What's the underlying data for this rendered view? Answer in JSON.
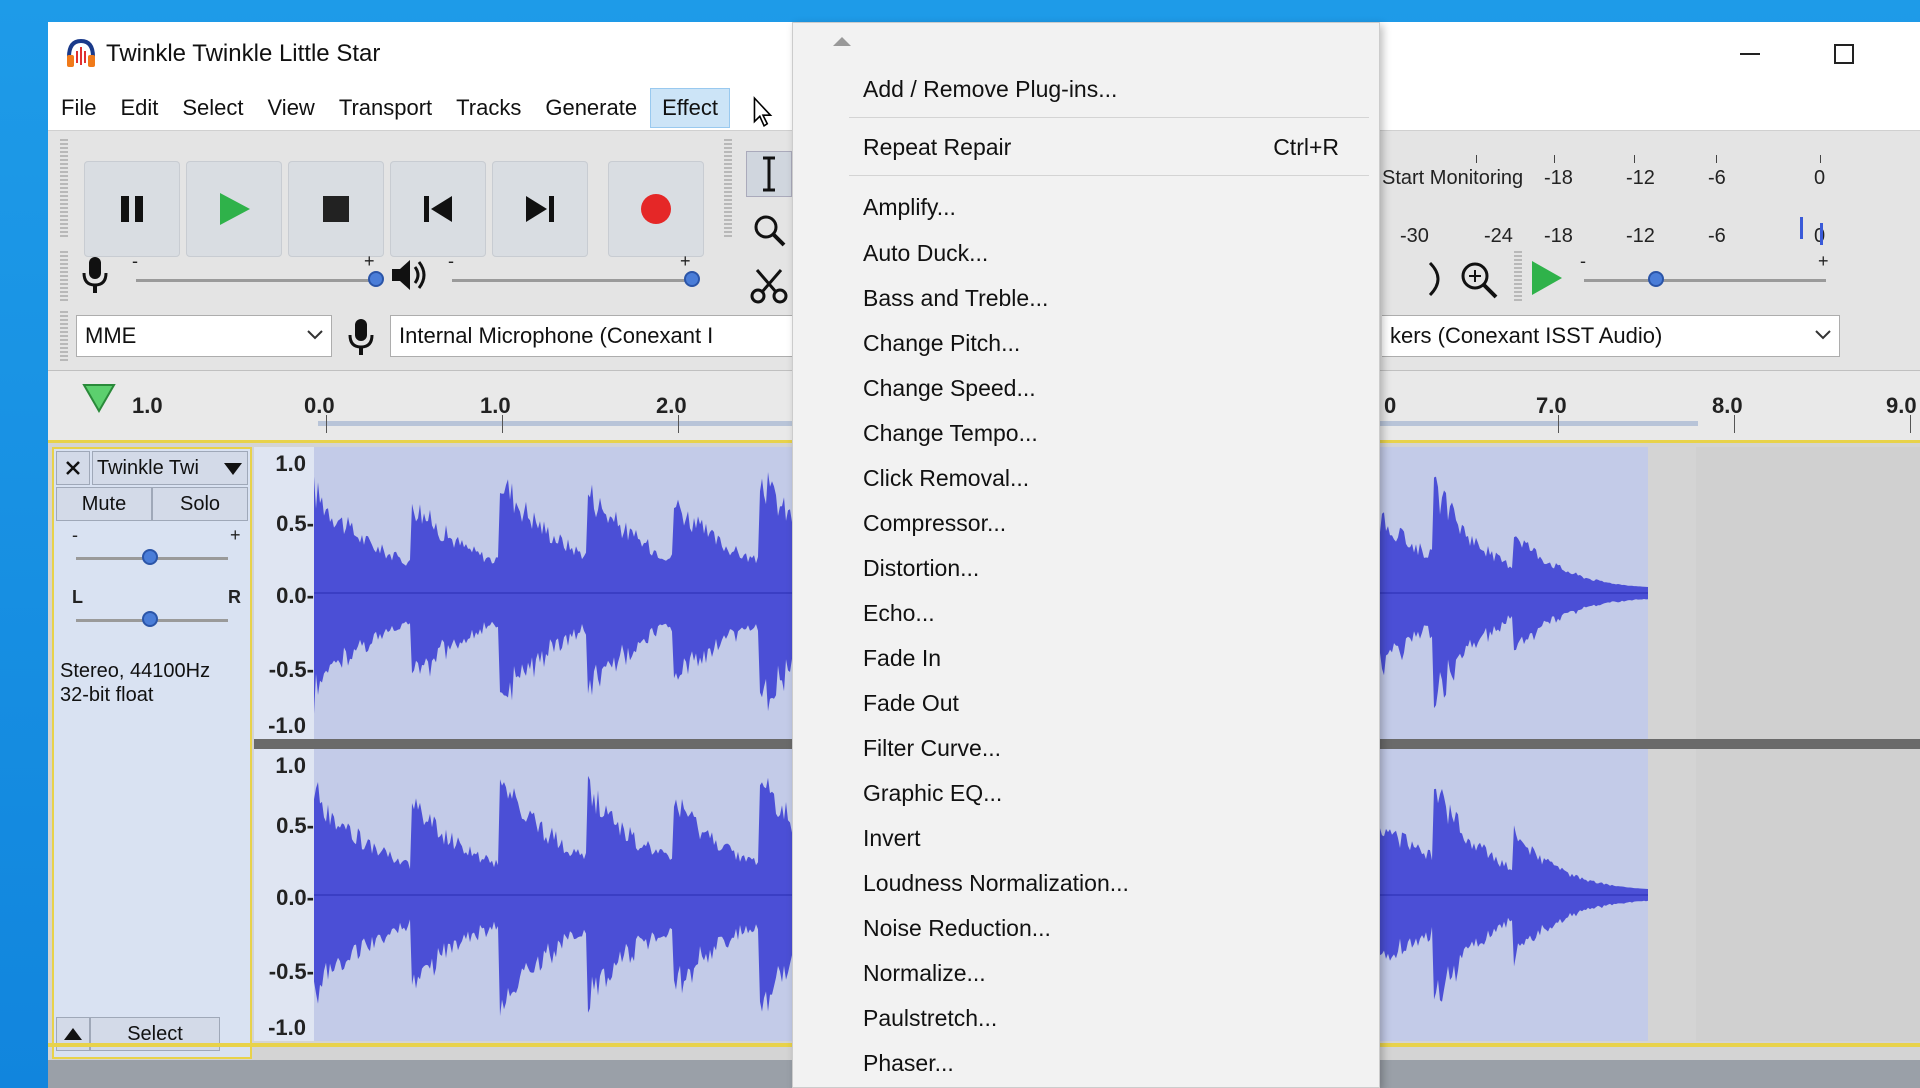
{
  "window": {
    "title": "Twinkle Twinkle Little Star"
  },
  "menubar": {
    "items": [
      "File",
      "Edit",
      "Select",
      "View",
      "Transport",
      "Tracks",
      "Generate",
      "Effect"
    ]
  },
  "devices": {
    "host": "MME",
    "input": "Internal Microphone (Conexant I",
    "output": "kers (Conexant ISST Audio)"
  },
  "meters": {
    "monitor_label": "Start Monitoring",
    "record_scale": [
      "-18",
      "-12",
      "-6",
      "0"
    ],
    "play_scale": [
      "-30",
      "-24",
      "-18",
      "-12",
      "-6",
      "0"
    ]
  },
  "sliders": {
    "minus": "-",
    "plus": "+"
  },
  "ruler": {
    "left_value": "1.0",
    "labels_left": [
      "0.0",
      "1.0",
      "2.0"
    ],
    "labels_right": [
      "0",
      "7.0",
      "8.0",
      "9.0"
    ]
  },
  "track": {
    "name": "Twinkle Twi",
    "mute": "Mute",
    "solo": "Solo",
    "pan_left": "L",
    "pan_right": "R",
    "gain_minus": "-",
    "gain_plus": "+",
    "info_line1": "Stereo, 44100Hz",
    "info_line2": "32-bit float",
    "select": "Select",
    "scale": [
      "1.0",
      "0.5-",
      "0.0-",
      "-0.5-",
      "-1.0"
    ]
  },
  "effect_menu": {
    "items": [
      {
        "label": "Add / Remove Plug-ins...",
        "shortcut": ""
      },
      {
        "label": "Repeat Repair",
        "shortcut": "Ctrl+R"
      },
      {
        "label": "Amplify...",
        "shortcut": ""
      },
      {
        "label": "Auto Duck...",
        "shortcut": ""
      },
      {
        "label": "Bass and Treble...",
        "shortcut": ""
      },
      {
        "label": "Change Pitch...",
        "shortcut": ""
      },
      {
        "label": "Change Speed...",
        "shortcut": ""
      },
      {
        "label": "Change Tempo...",
        "shortcut": ""
      },
      {
        "label": "Click Removal...",
        "shortcut": ""
      },
      {
        "label": "Compressor...",
        "shortcut": ""
      },
      {
        "label": "Distortion...",
        "shortcut": ""
      },
      {
        "label": "Echo...",
        "shortcut": ""
      },
      {
        "label": "Fade In",
        "shortcut": ""
      },
      {
        "label": "Fade Out",
        "shortcut": ""
      },
      {
        "label": "Filter Curve...",
        "shortcut": ""
      },
      {
        "label": "Graphic EQ...",
        "shortcut": ""
      },
      {
        "label": "Invert",
        "shortcut": ""
      },
      {
        "label": "Loudness Normalization...",
        "shortcut": ""
      },
      {
        "label": "Noise Reduction...",
        "shortcut": ""
      },
      {
        "label": "Normalize...",
        "shortcut": ""
      },
      {
        "label": "Paulstretch...",
        "shortcut": ""
      },
      {
        "label": "Phaser...",
        "shortcut": ""
      }
    ]
  },
  "colors": {
    "waveform": "#4b4fd6",
    "waveform_bg": "#c3cbe8",
    "play_green": "#2fb24a",
    "record_red": "#e52727",
    "menu_highlight": "#cce4f7"
  }
}
